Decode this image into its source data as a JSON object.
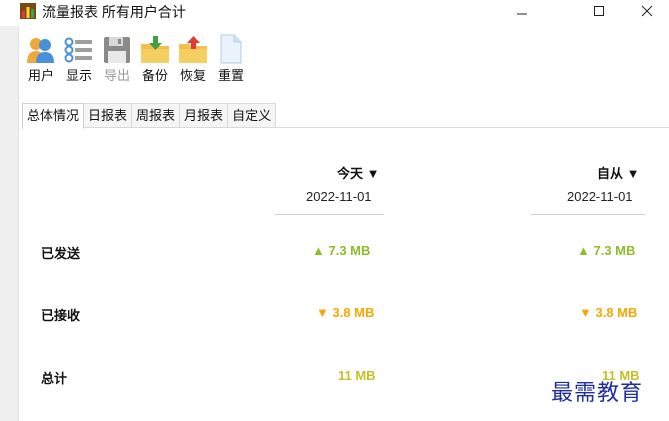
{
  "window": {
    "title": "流量报表 所有用户合计"
  },
  "toolbar": {
    "users": "用户",
    "display": "显示",
    "export": "导出",
    "backup": "备份",
    "restore": "恢复",
    "reset": "重置"
  },
  "tabs": [
    "总体情况",
    "日报表",
    "周报表",
    "月报表",
    "自定义"
  ],
  "columns": [
    {
      "header": "今天 ▼",
      "date": "2022-11-01"
    },
    {
      "header": "自从 ▼",
      "date": "2022-11-01"
    }
  ],
  "rows": [
    {
      "label": "已发送",
      "today": "▲ 7.3 MB",
      "since": "▲ 7.3 MB"
    },
    {
      "label": "已接收",
      "today": "▼ 3.8 MB",
      "since": "▼ 3.8 MB"
    },
    {
      "label": "总计",
      "today": "11 MB",
      "since": "11 MB"
    }
  ],
  "watermark": "最需教育",
  "colors": {
    "sent": "#8ebc2a",
    "received": "#f5a800",
    "total": "#c6c026"
  }
}
